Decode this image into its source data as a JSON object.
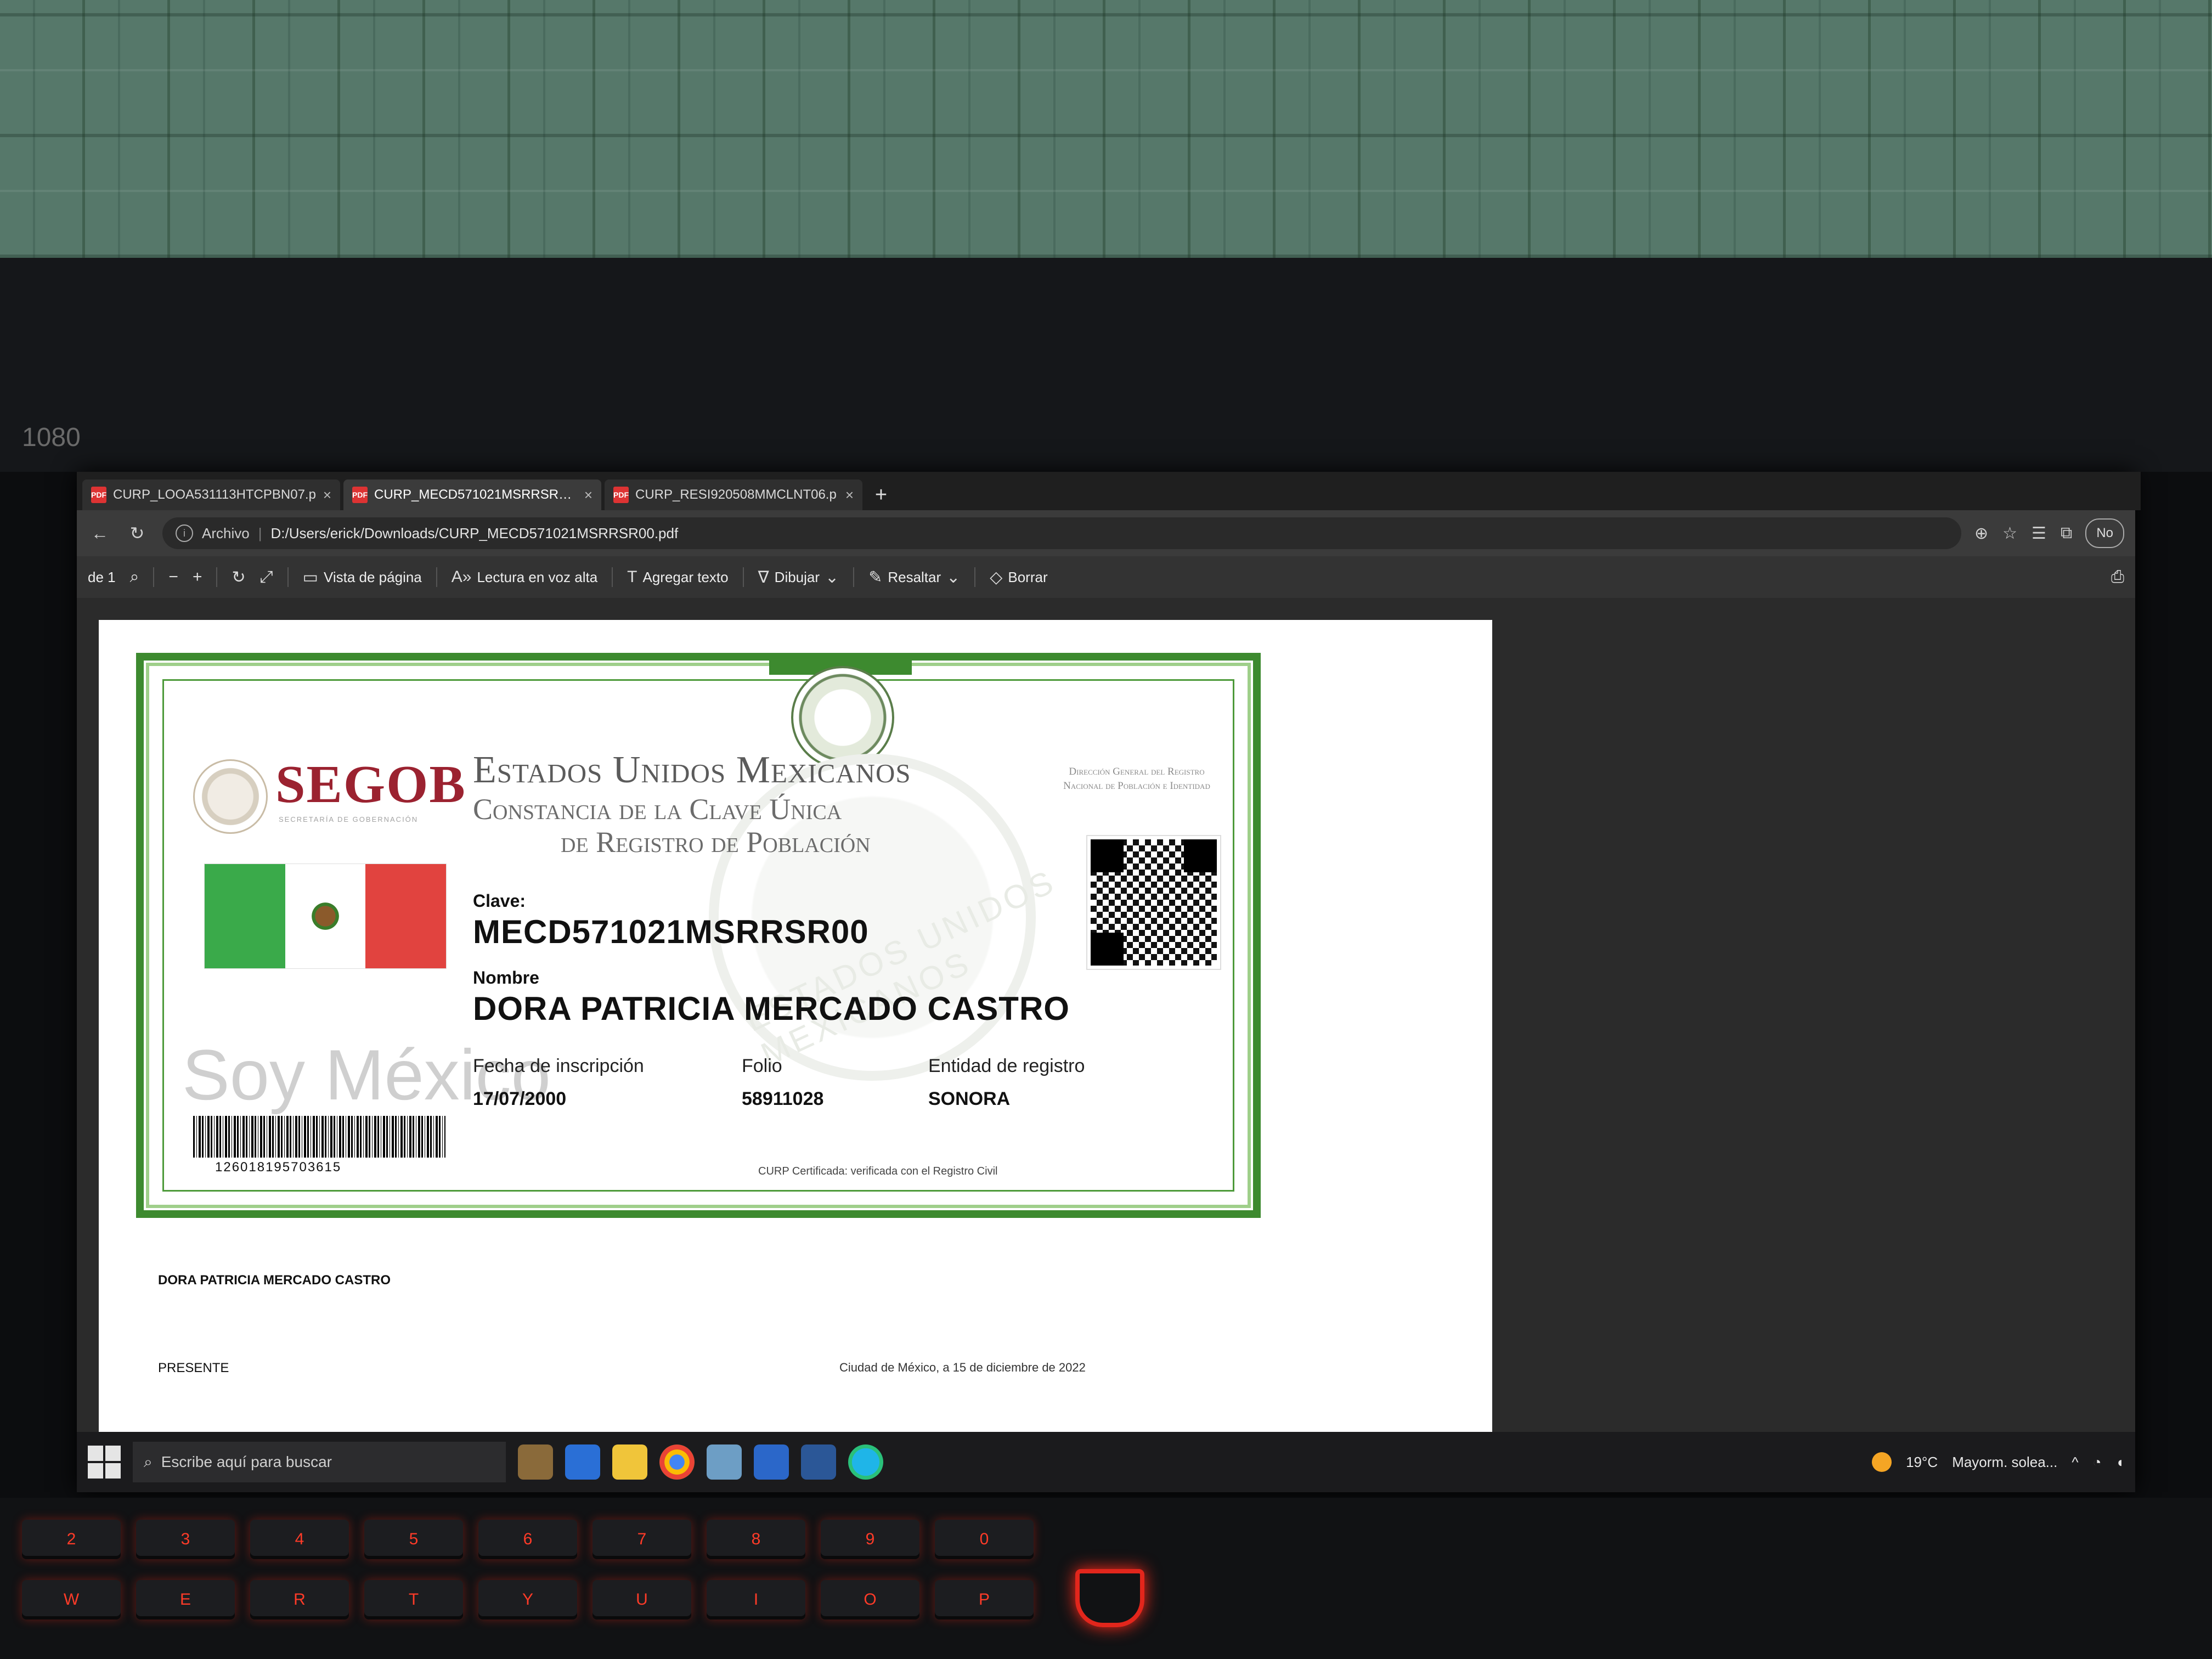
{
  "browser": {
    "tabs": [
      {
        "label": "CURP_LOOA531113HTCPBN07.p"
      },
      {
        "label": "CURP_MECD571021MSRRSR00.p"
      },
      {
        "label": "CURP_RESI920508MMCLNT06.p"
      }
    ],
    "new_tab": "+",
    "close": "×",
    "address": {
      "scheme": "Archivo",
      "url": "D:/Users/erick/Downloads/CURP_MECD571021MSRRSR00.pdf"
    },
    "no_pill": "No"
  },
  "pdf_toolbar": {
    "page_total": "de 1",
    "zoom_minus": "−",
    "zoom_plus": "+",
    "page_view": "Vista de página",
    "read_aloud": "Lectura en voz alta",
    "add_text": "Agregar texto",
    "draw": "Dibujar",
    "highlight": "Resaltar",
    "erase": "Borrar"
  },
  "certificate": {
    "segob": "SEGOB",
    "segob_sub": "SECRETARÍA DE GOBERNACIÓN",
    "soy_mexico": "Soy México",
    "title_line1": "Estados Unidos Mexicanos",
    "title_line2": "Constancia de la Clave Única",
    "title_line3": "de Registro de Población",
    "dgr": "Dirección General del Registro Nacional de Población e Identidad",
    "watermark": "ESTADOS UNIDOS MEXICANOS",
    "clave_label": "Clave:",
    "clave_value": "MECD571021MSRRSR00",
    "nombre_label": "Nombre",
    "nombre_value": "DORA PATRICIA MERCADO CASTRO",
    "fecha_label": "Fecha de inscripción",
    "fecha_value": "17/07/2000",
    "folio_label": "Folio",
    "folio_value": "58911028",
    "entidad_label": "Entidad de registro",
    "entidad_value": "SONORA",
    "barcode_number": "126018195703615",
    "note": "CURP Certificada: verificada con el Registro Civil"
  },
  "page_below": {
    "name": "DORA PATRICIA MERCADO CASTRO",
    "presente": "PRESENTE",
    "ciudad": "Ciudad de México, a 15 de diciembre de 2022"
  },
  "taskbar": {
    "search_placeholder": "Escribe aquí para buscar",
    "temperature": "19°C",
    "weather": "Mayorm. solea...",
    "tray_arrow": "^"
  },
  "keyboard": {
    "keys_row1": [
      "W",
      "E",
      "R",
      "T",
      "Y",
      "U",
      "I",
      "O",
      "P"
    ],
    "keys_row2": [
      "2",
      "3",
      "4",
      "5",
      "6",
      "7",
      "8",
      "9",
      "0"
    ]
  },
  "bezel": {
    "label": "1080"
  },
  "colors": {
    "segob_red": "#9b2230",
    "frame_green": "#3d8a2f",
    "flag_green": "#3aaa4a",
    "flag_red": "#e1433f",
    "key_led": "#ff3b28"
  }
}
